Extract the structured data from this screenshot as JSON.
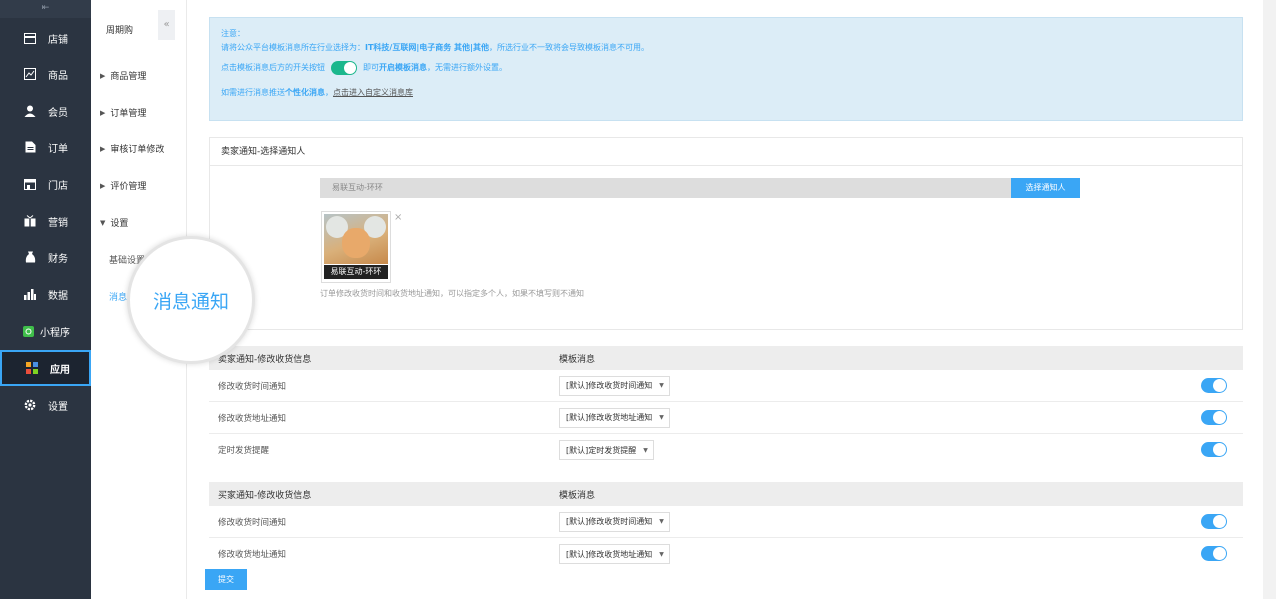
{
  "nav": {
    "collapse_icon": "⇤",
    "items": [
      {
        "label": "店铺",
        "icon": "store-icon"
      },
      {
        "label": "商品",
        "icon": "goods-icon"
      },
      {
        "label": "会员",
        "icon": "member-icon"
      },
      {
        "label": "订单",
        "icon": "order-icon"
      },
      {
        "label": "门店",
        "icon": "shop-icon"
      },
      {
        "label": "营销",
        "icon": "marketing-icon"
      },
      {
        "label": "财务",
        "icon": "finance-icon"
      },
      {
        "label": "数据",
        "icon": "chart-icon"
      },
      {
        "label": "小程序",
        "icon": "miniapp-icon"
      },
      {
        "label": "应用",
        "icon": "apps-icon"
      },
      {
        "label": "设置",
        "icon": "gear-icon"
      }
    ]
  },
  "subnav": {
    "title": "周期购",
    "toggle": "«",
    "items": [
      "商品管理",
      "订单管理",
      "审核订单修改",
      "评价管理",
      "设置"
    ],
    "leaves": [
      "基础设置",
      "消息"
    ]
  },
  "magnifier_text": "消息通知",
  "notice": {
    "line1": "注意：",
    "line2_prefix": "请将公众平台模板消息所在行业选择为：",
    "line2_bold": "IT科技/互联网|电子商务 其他|其他",
    "line2_suffix": "，所选行业不一致将会导致模板消息不可用。",
    "line3_prefix": "点击模板消息后方的开关按钮",
    "line3_bold_prefix": "即可",
    "line3_bold": "开启模板消息",
    "line3_suffix": "，无需进行额外设置。",
    "line4_prefix": "如需进行消息推送",
    "line4_bold": "个性化消息",
    "line4_mid": "，",
    "line4_link": "点击进入自定义消息库"
  },
  "seller": {
    "header": "卖家通知-选择通知人",
    "input_value": "易联互动-环环",
    "pick_button": "选择通知人",
    "avatar_name": "易联互动-环环",
    "close": "×",
    "help": "订单修改收货时间和收货地址通知，可以指定多个人，如果不填写则不通知"
  },
  "seller_table": {
    "col1": "卖家通知-修改收货信息",
    "col2": "模板消息",
    "rows": [
      {
        "name": "修改收货时间通知",
        "template": "[默认]修改收货时间通知",
        "enabled": true
      },
      {
        "name": "修改收货地址通知",
        "template": "[默认]修改收货地址通知",
        "enabled": true
      },
      {
        "name": "定时发货提醒",
        "template": "[默认]定时发货提醒",
        "enabled": true
      }
    ]
  },
  "buyer_table": {
    "col1": "买家通知-修改收货信息",
    "col2": "模板消息",
    "rows": [
      {
        "name": "修改收货时间通知",
        "template": "[默认]修改收货时间通知",
        "enabled": true
      },
      {
        "name": "修改收货地址通知",
        "template": "[默认]修改收货地址通知",
        "enabled": true
      }
    ]
  },
  "submit_label": "提交",
  "colors": {
    "accent": "#3aa6f5",
    "nav_bg": "#2b3441",
    "toggle_green": "#1bb78c"
  }
}
